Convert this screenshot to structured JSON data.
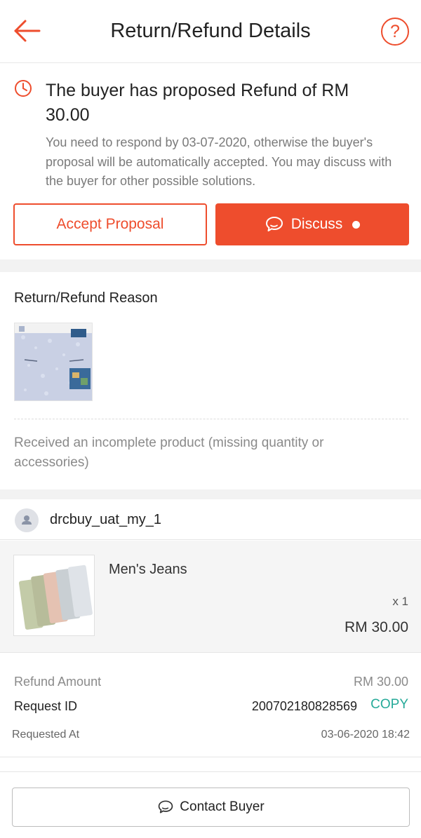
{
  "header": {
    "title": "Return/Refund Details",
    "help_label": "?"
  },
  "proposal": {
    "title": "The buyer has proposed Refund of RM 30.00",
    "description": "You need to respond by 03-07-2020, otherwise the buyer's proposal will be automatically accepted. You may discuss with the buyer for other possible solutions.",
    "accept_label": "Accept Proposal",
    "discuss_label": "Discuss"
  },
  "reason": {
    "title": "Return/Refund Reason",
    "text": "Received an incomplete product (missing quantity or accessories)"
  },
  "buyer": {
    "username": "drcbuy_uat_my_1"
  },
  "product": {
    "name": "Men's Jeans",
    "quantity": "x 1",
    "price": "RM 30.00"
  },
  "summary": {
    "refund_amount_label": "Refund Amount",
    "refund_amount_value": "RM 30.00",
    "request_id_label": "Request ID",
    "request_id_value": "200702180828569",
    "copy_label": "COPY",
    "requested_at_label": "Requested At",
    "requested_at_value": "03-06-2020 18:42"
  },
  "footer": {
    "contact_label": "Contact Buyer"
  },
  "icons": [
    "back-arrow-icon",
    "help-icon",
    "clock-icon",
    "chat-bubble-icon",
    "user-icon"
  ],
  "colors": {
    "accent": "#ee4d2d",
    "copy": "#26aa99",
    "muted_text": "#8a8a8a",
    "divider": "#f2f2f2"
  }
}
